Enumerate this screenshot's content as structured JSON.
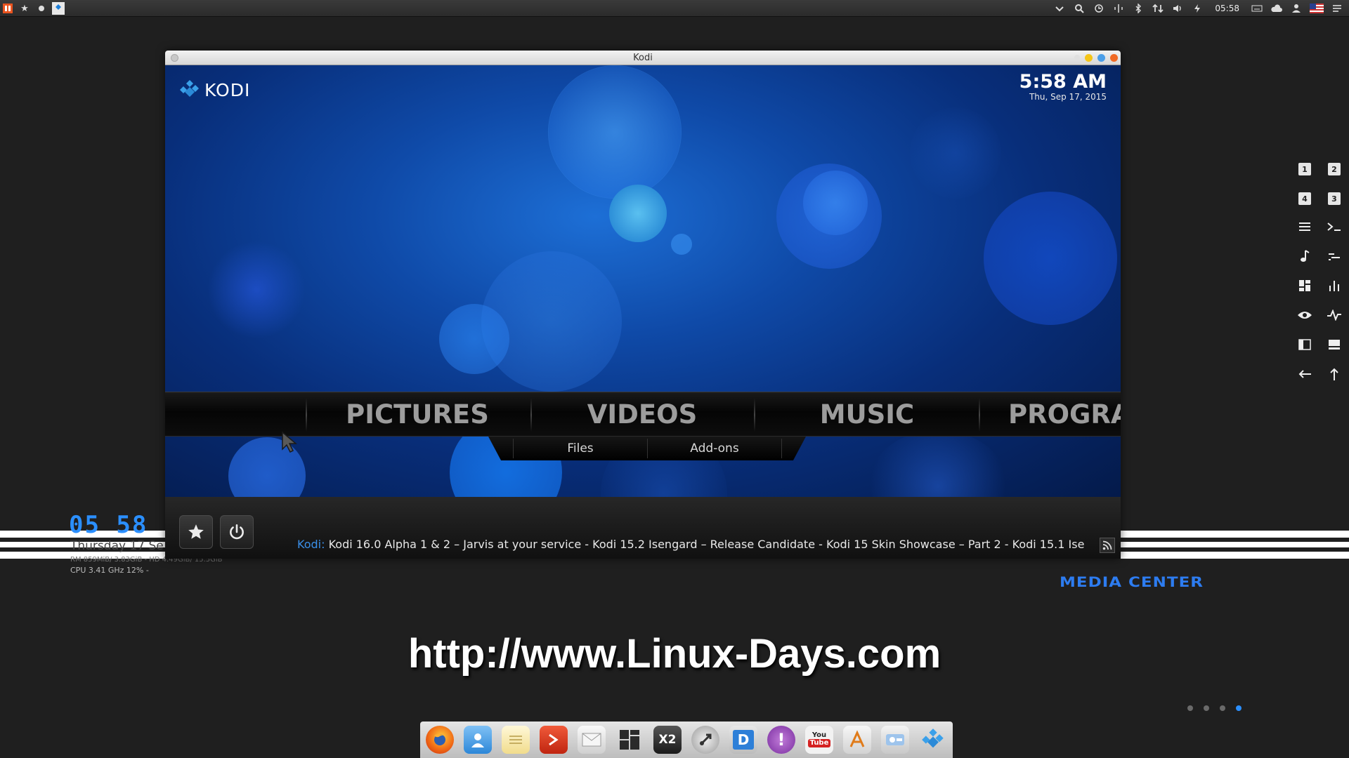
{
  "top_panel": {
    "clock": "05:58",
    "left_icons": [
      "ubuntu-logo-icon",
      "star-icon",
      "dot-icon",
      "kodi-icon"
    ],
    "right_icons": [
      "chevron-down-icon",
      "search-icon",
      "history-icon",
      "network-icon",
      "bluetooth-icon",
      "transfer-icon",
      "volume-icon",
      "power-icon"
    ]
  },
  "conky": {
    "time": "05 58",
    "date": "Thursday 17 Se",
    "mem": "RM 859MiB/ 3.83GiB - HD 4.49GiB/ 15.5GiB",
    "cpu": "CPU 3.41 GHz 12% -"
  },
  "window": {
    "title": "Kodi"
  },
  "kodi": {
    "logo_text": "KODI",
    "clock_time": "5:58 AM",
    "clock_date": "Thu, Sep 17, 2015",
    "menu": [
      "PICTURES",
      "VIDEOS",
      "MUSIC",
      "PROGRA"
    ],
    "submenu": [
      "Files",
      "Add-ons"
    ],
    "ticker_source": "Kodi:",
    "ticker_text": "Kodi 16.0 Alpha 1 & 2 – Jarvis at your service - Kodi 15.2 Isengard – Release Candidate - Kodi 15 Skin Showcase – Part 2 - Kodi 15.1 Ise"
  },
  "side_grid": {
    "labels": [
      "1",
      "2",
      "4",
      "3"
    ]
  },
  "desktop": {
    "media_center": "MEDIA CENTER",
    "url": "http://www.Linux-Days.com",
    "pager_count": 4,
    "pager_active": 4
  },
  "dock": {
    "icons": [
      "firefox-icon",
      "contacts-icon",
      "notes-icon",
      "terminal-icon",
      "mail-icon",
      "workspace-icon",
      "x2-icon",
      "steam-icon",
      "dictionary-icon",
      "pidgin-icon",
      "youtube-icon",
      "app-store-icon",
      "settings-icon",
      "kodi-icon"
    ],
    "labels": {
      "x2": "X2",
      "dictionary": "D",
      "youtube_top": "You",
      "youtube_bottom": "Tube"
    }
  },
  "colors": {
    "accent_blue": "#2b8fff",
    "kodi_blue": "#1d6fd6",
    "ticker_source": "#3a8fe8"
  }
}
